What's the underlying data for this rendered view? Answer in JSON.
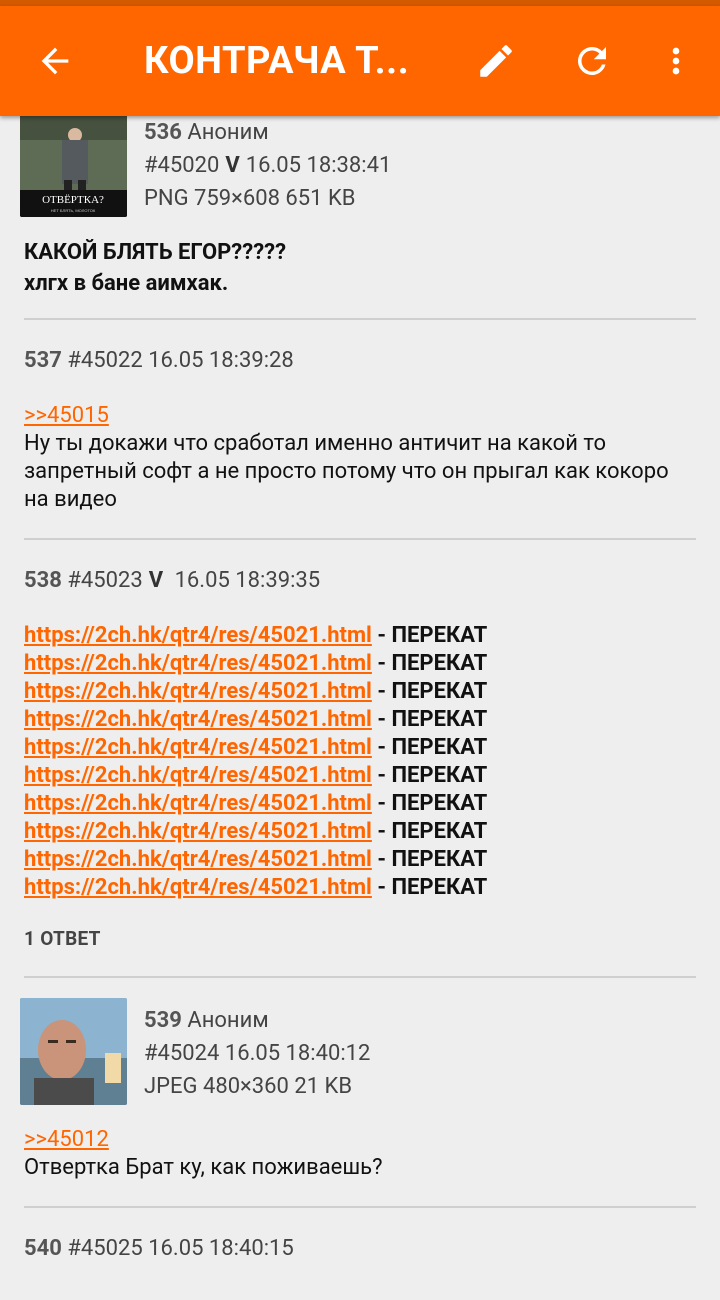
{
  "appbar": {
    "title": "КОНТРАЧА Т...",
    "back_icon": "arrow-back-icon",
    "edit_icon": "pencil-icon",
    "refresh_icon": "refresh-icon",
    "more_icon": "more-vert-icon",
    "color": "#ff6600"
  },
  "posts": [
    {
      "num": "536",
      "author": "Аноним",
      "id": "#45020",
      "op_mark": "V",
      "date": "16.05 18:38:41",
      "file": "PNG 759×608 651 KB",
      "thumb_caption": "ОТВЁРТКА?",
      "thumb_subcaption": "НЕТ БЛЯТЬ, МОЛОТОК",
      "lines": [
        "КАКОЙ БЛЯТЬ ЕГОР?????",
        "хлгх в бане аимхак."
      ]
    },
    {
      "num": "537",
      "id": "#45022",
      "date": "16.05 18:39:28",
      "reply_link": ">>45015",
      "text": "Ну ты докажи что сработал именно античит на какой то запретный софт а не просто потому что он прыгал как кокоро на видео"
    },
    {
      "num": "538",
      "id": "#45023",
      "op_mark": "V",
      "date": "16.05 18:39:35",
      "link_lines": [
        {
          "url": "https://2ch.hk/qtr4/res/45021.html",
          "suffix": " - ПЕРЕКАТ"
        },
        {
          "url": "https://2ch.hk/qtr4/res/45021.html",
          "suffix": " - ПЕРЕКАТ"
        },
        {
          "url": "https://2ch.hk/qtr4/res/45021.html",
          "suffix": " - ПЕРЕКАТ"
        },
        {
          "url": "https://2ch.hk/qtr4/res/45021.html",
          "suffix": " - ПЕРЕКАТ"
        },
        {
          "url": "https://2ch.hk/qtr4/res/45021.html",
          "suffix": " - ПЕРЕКАТ"
        },
        {
          "url": "https://2ch.hk/qtr4/res/45021.html",
          "suffix": " - ПЕРЕКАТ"
        },
        {
          "url": "https://2ch.hk/qtr4/res/45021.html",
          "suffix": " - ПЕРЕКАТ"
        },
        {
          "url": "https://2ch.hk/qtr4/res/45021.html",
          "suffix": " - ПЕРЕКАТ"
        },
        {
          "url": "https://2ch.hk/qtr4/res/45021.html",
          "suffix": " - ПЕРЕКАТ"
        },
        {
          "url": "https://2ch.hk/qtr4/res/45021.html",
          "suffix": " - ПЕРЕКАТ"
        }
      ],
      "replies": "1 ОТВЕТ"
    },
    {
      "num": "539",
      "author": "Аноним",
      "id": "#45024",
      "date": "16.05 18:40:12",
      "file": "JPEG 480×360 21 KB",
      "reply_link": ">>45012",
      "text": "Отвертка Брат ку, как поживаешь?"
    },
    {
      "num": "540",
      "id": "#45025",
      "date": "16.05 18:40:15"
    }
  ]
}
